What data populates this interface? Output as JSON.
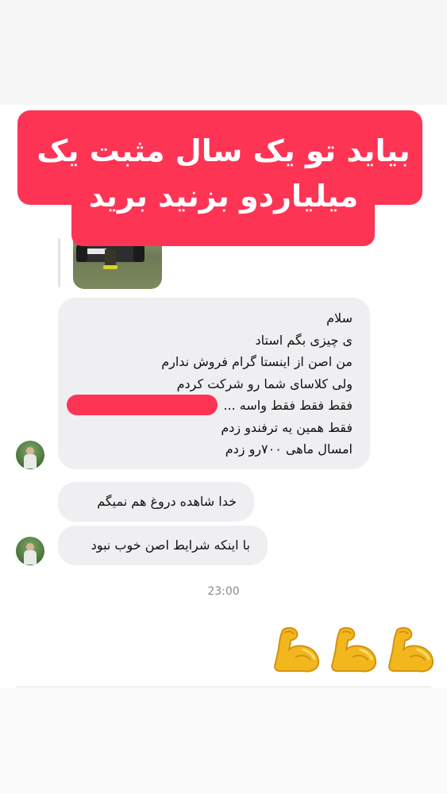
{
  "banner": {
    "line1": "بیاید تو یک سال مثبت یک",
    "line2": "میلیاردو بزنید برید",
    "color": "#fe3455"
  },
  "chat": {
    "messages": [
      "سلام",
      "ی چیزی بگم استاد",
      "من اصن از اینستا گرام فروش ندارم",
      "ولی کلاسای شما رو شرکت کردم",
      "فقط فقط فقط واسه ...",
      "فقط همین یه ترفندو زدم",
      "امسال ماهی ۷۰۰رو زدم"
    ],
    "message2": "خدا شاهده دروغ هم نمیگم",
    "message3": "با اینکه شرایط اصن خوب نبود",
    "timestamp": "23:00",
    "reaction_emojis": [
      "flexed-biceps",
      "flexed-biceps",
      "flexed-biceps"
    ]
  },
  "colors": {
    "bubble": "#efeff1",
    "redaction": "#fe3455"
  }
}
